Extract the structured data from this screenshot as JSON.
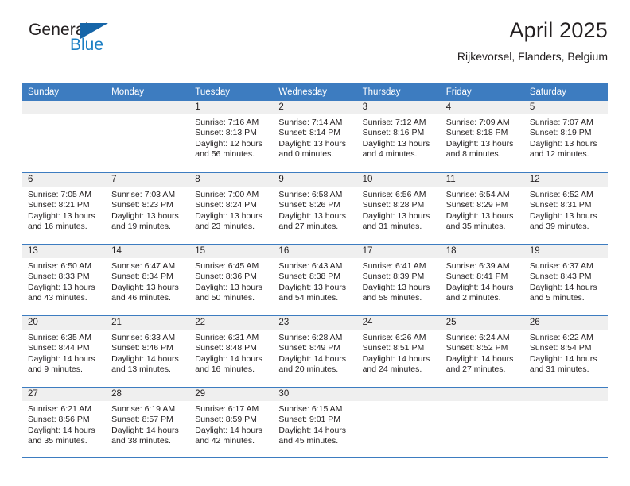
{
  "brand": {
    "name_part1": "General",
    "name_part2": "Blue",
    "triangle_icon": "triangle-icon",
    "colors": {
      "dark": "#231f20",
      "blue": "#1c7fc4",
      "triangle": "#1665a8"
    }
  },
  "header": {
    "title": "April 2025",
    "subtitle": "Rijkevorsel, Flanders, Belgium"
  },
  "theme": {
    "header_blue": "#3d7cc0",
    "daynum_band": "#efefef",
    "text": "#231f20"
  },
  "weekdays": [
    "Sunday",
    "Monday",
    "Tuesday",
    "Wednesday",
    "Thursday",
    "Friday",
    "Saturday"
  ],
  "weeks": [
    [
      {
        "day": ""
      },
      {
        "day": ""
      },
      {
        "day": "1",
        "sunrise": "Sunrise: 7:16 AM",
        "sunset": "Sunset: 8:13 PM",
        "daylight_1": "Daylight: 12 hours",
        "daylight_2": "and 56 minutes."
      },
      {
        "day": "2",
        "sunrise": "Sunrise: 7:14 AM",
        "sunset": "Sunset: 8:14 PM",
        "daylight_1": "Daylight: 13 hours",
        "daylight_2": "and 0 minutes."
      },
      {
        "day": "3",
        "sunrise": "Sunrise: 7:12 AM",
        "sunset": "Sunset: 8:16 PM",
        "daylight_1": "Daylight: 13 hours",
        "daylight_2": "and 4 minutes."
      },
      {
        "day": "4",
        "sunrise": "Sunrise: 7:09 AM",
        "sunset": "Sunset: 8:18 PM",
        "daylight_1": "Daylight: 13 hours",
        "daylight_2": "and 8 minutes."
      },
      {
        "day": "5",
        "sunrise": "Sunrise: 7:07 AM",
        "sunset": "Sunset: 8:19 PM",
        "daylight_1": "Daylight: 13 hours",
        "daylight_2": "and 12 minutes."
      }
    ],
    [
      {
        "day": "6",
        "sunrise": "Sunrise: 7:05 AM",
        "sunset": "Sunset: 8:21 PM",
        "daylight_1": "Daylight: 13 hours",
        "daylight_2": "and 16 minutes."
      },
      {
        "day": "7",
        "sunrise": "Sunrise: 7:03 AM",
        "sunset": "Sunset: 8:23 PM",
        "daylight_1": "Daylight: 13 hours",
        "daylight_2": "and 19 minutes."
      },
      {
        "day": "8",
        "sunrise": "Sunrise: 7:00 AM",
        "sunset": "Sunset: 8:24 PM",
        "daylight_1": "Daylight: 13 hours",
        "daylight_2": "and 23 minutes."
      },
      {
        "day": "9",
        "sunrise": "Sunrise: 6:58 AM",
        "sunset": "Sunset: 8:26 PM",
        "daylight_1": "Daylight: 13 hours",
        "daylight_2": "and 27 minutes."
      },
      {
        "day": "10",
        "sunrise": "Sunrise: 6:56 AM",
        "sunset": "Sunset: 8:28 PM",
        "daylight_1": "Daylight: 13 hours",
        "daylight_2": "and 31 minutes."
      },
      {
        "day": "11",
        "sunrise": "Sunrise: 6:54 AM",
        "sunset": "Sunset: 8:29 PM",
        "daylight_1": "Daylight: 13 hours",
        "daylight_2": "and 35 minutes."
      },
      {
        "day": "12",
        "sunrise": "Sunrise: 6:52 AM",
        "sunset": "Sunset: 8:31 PM",
        "daylight_1": "Daylight: 13 hours",
        "daylight_2": "and 39 minutes."
      }
    ],
    [
      {
        "day": "13",
        "sunrise": "Sunrise: 6:50 AM",
        "sunset": "Sunset: 8:33 PM",
        "daylight_1": "Daylight: 13 hours",
        "daylight_2": "and 43 minutes."
      },
      {
        "day": "14",
        "sunrise": "Sunrise: 6:47 AM",
        "sunset": "Sunset: 8:34 PM",
        "daylight_1": "Daylight: 13 hours",
        "daylight_2": "and 46 minutes."
      },
      {
        "day": "15",
        "sunrise": "Sunrise: 6:45 AM",
        "sunset": "Sunset: 8:36 PM",
        "daylight_1": "Daylight: 13 hours",
        "daylight_2": "and 50 minutes."
      },
      {
        "day": "16",
        "sunrise": "Sunrise: 6:43 AM",
        "sunset": "Sunset: 8:38 PM",
        "daylight_1": "Daylight: 13 hours",
        "daylight_2": "and 54 minutes."
      },
      {
        "day": "17",
        "sunrise": "Sunrise: 6:41 AM",
        "sunset": "Sunset: 8:39 PM",
        "daylight_1": "Daylight: 13 hours",
        "daylight_2": "and 58 minutes."
      },
      {
        "day": "18",
        "sunrise": "Sunrise: 6:39 AM",
        "sunset": "Sunset: 8:41 PM",
        "daylight_1": "Daylight: 14 hours",
        "daylight_2": "and 2 minutes."
      },
      {
        "day": "19",
        "sunrise": "Sunrise: 6:37 AM",
        "sunset": "Sunset: 8:43 PM",
        "daylight_1": "Daylight: 14 hours",
        "daylight_2": "and 5 minutes."
      }
    ],
    [
      {
        "day": "20",
        "sunrise": "Sunrise: 6:35 AM",
        "sunset": "Sunset: 8:44 PM",
        "daylight_1": "Daylight: 14 hours",
        "daylight_2": "and 9 minutes."
      },
      {
        "day": "21",
        "sunrise": "Sunrise: 6:33 AM",
        "sunset": "Sunset: 8:46 PM",
        "daylight_1": "Daylight: 14 hours",
        "daylight_2": "and 13 minutes."
      },
      {
        "day": "22",
        "sunrise": "Sunrise: 6:31 AM",
        "sunset": "Sunset: 8:48 PM",
        "daylight_1": "Daylight: 14 hours",
        "daylight_2": "and 16 minutes."
      },
      {
        "day": "23",
        "sunrise": "Sunrise: 6:28 AM",
        "sunset": "Sunset: 8:49 PM",
        "daylight_1": "Daylight: 14 hours",
        "daylight_2": "and 20 minutes."
      },
      {
        "day": "24",
        "sunrise": "Sunrise: 6:26 AM",
        "sunset": "Sunset: 8:51 PM",
        "daylight_1": "Daylight: 14 hours",
        "daylight_2": "and 24 minutes."
      },
      {
        "day": "25",
        "sunrise": "Sunrise: 6:24 AM",
        "sunset": "Sunset: 8:52 PM",
        "daylight_1": "Daylight: 14 hours",
        "daylight_2": "and 27 minutes."
      },
      {
        "day": "26",
        "sunrise": "Sunrise: 6:22 AM",
        "sunset": "Sunset: 8:54 PM",
        "daylight_1": "Daylight: 14 hours",
        "daylight_2": "and 31 minutes."
      }
    ],
    [
      {
        "day": "27",
        "sunrise": "Sunrise: 6:21 AM",
        "sunset": "Sunset: 8:56 PM",
        "daylight_1": "Daylight: 14 hours",
        "daylight_2": "and 35 minutes."
      },
      {
        "day": "28",
        "sunrise": "Sunrise: 6:19 AM",
        "sunset": "Sunset: 8:57 PM",
        "daylight_1": "Daylight: 14 hours",
        "daylight_2": "and 38 minutes."
      },
      {
        "day": "29",
        "sunrise": "Sunrise: 6:17 AM",
        "sunset": "Sunset: 8:59 PM",
        "daylight_1": "Daylight: 14 hours",
        "daylight_2": "and 42 minutes."
      },
      {
        "day": "30",
        "sunrise": "Sunrise: 6:15 AM",
        "sunset": "Sunset: 9:01 PM",
        "daylight_1": "Daylight: 14 hours",
        "daylight_2": "and 45 minutes."
      },
      {
        "day": ""
      },
      {
        "day": ""
      },
      {
        "day": ""
      }
    ]
  ]
}
